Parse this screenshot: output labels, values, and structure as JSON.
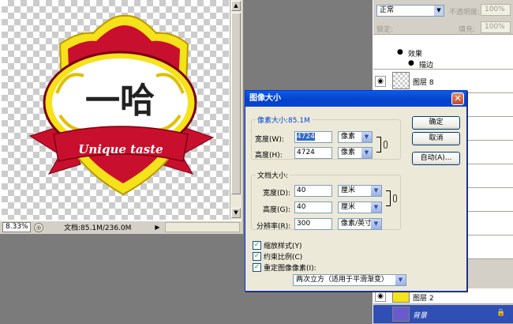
{
  "document": {
    "zoom": "8.33%",
    "doc_size": "文档:85.1M/236.0M",
    "logo_text": "Unique taste",
    "logo_glyph": "一哈"
  },
  "layers": {
    "blend_mode": "正常",
    "opacity_label": "不透明度:",
    "opacity_value": "100%",
    "lock_label": "锁定:",
    "fill_label": "填充:",
    "fill_value": "100%",
    "items": [
      {
        "name": "效果"
      },
      {
        "name": "描边"
      },
      {
        "name": "图层 8"
      },
      {
        "name": "图层 2"
      },
      {
        "name": "背景"
      }
    ]
  },
  "dialog": {
    "title": "图像大小",
    "close_label": "✕",
    "pixel_group": {
      "legend": "像素大小:85.1M",
      "width_label": "宽度(W):",
      "width_value": "4724",
      "width_unit": "像素",
      "height_label": "高度(H):",
      "height_value": "4724",
      "height_unit": "像素"
    },
    "doc_group": {
      "legend": "文档大小:",
      "width_label": "宽度(D):",
      "width_value": "40",
      "width_unit": "厘米",
      "height_label": "高度(G):",
      "height_value": "40",
      "height_unit": "厘米",
      "res_label": "分辨率(R):",
      "res_value": "300",
      "res_unit": "像素/英寸"
    },
    "buttons": {
      "ok": "确定",
      "cancel": "取消",
      "auto": "自动(A)..."
    },
    "options": {
      "scale_styles": "缩放样式(Y)",
      "constrain": "约束比例(C)",
      "resample": "重定图像像素(I):"
    },
    "resample_method": "两次立方（适用于平滑渐变）"
  },
  "colors": {
    "title_blue": "#0a5ce8",
    "selected_layer": "#2f4fb5",
    "badge_red": "#c8102e",
    "badge_yellow": "#f5e21a"
  }
}
